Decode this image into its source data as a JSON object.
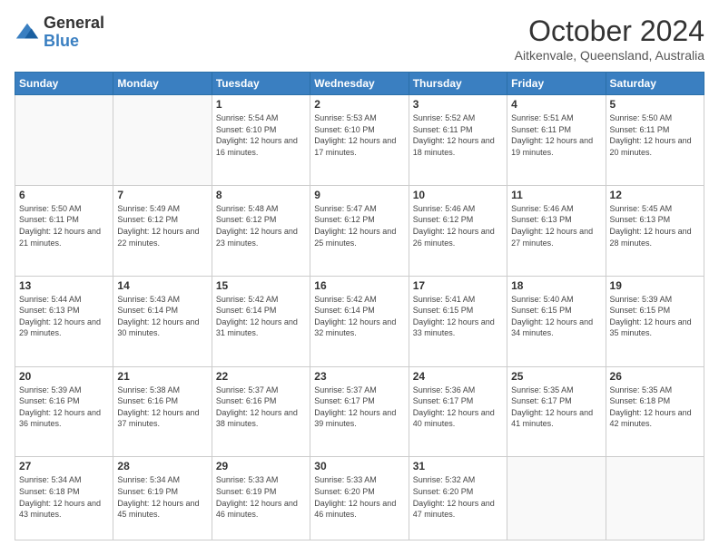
{
  "header": {
    "logo_general": "General",
    "logo_blue": "Blue",
    "month_title": "October 2024",
    "subtitle": "Aitkenvale, Queensland, Australia"
  },
  "days_of_week": [
    "Sunday",
    "Monday",
    "Tuesday",
    "Wednesday",
    "Thursday",
    "Friday",
    "Saturday"
  ],
  "weeks": [
    [
      {
        "day": "",
        "info": ""
      },
      {
        "day": "",
        "info": ""
      },
      {
        "day": "1",
        "info": "Sunrise: 5:54 AM\nSunset: 6:10 PM\nDaylight: 12 hours and 16 minutes."
      },
      {
        "day": "2",
        "info": "Sunrise: 5:53 AM\nSunset: 6:10 PM\nDaylight: 12 hours and 17 minutes."
      },
      {
        "day": "3",
        "info": "Sunrise: 5:52 AM\nSunset: 6:11 PM\nDaylight: 12 hours and 18 minutes."
      },
      {
        "day": "4",
        "info": "Sunrise: 5:51 AM\nSunset: 6:11 PM\nDaylight: 12 hours and 19 minutes."
      },
      {
        "day": "5",
        "info": "Sunrise: 5:50 AM\nSunset: 6:11 PM\nDaylight: 12 hours and 20 minutes."
      }
    ],
    [
      {
        "day": "6",
        "info": "Sunrise: 5:50 AM\nSunset: 6:11 PM\nDaylight: 12 hours and 21 minutes."
      },
      {
        "day": "7",
        "info": "Sunrise: 5:49 AM\nSunset: 6:12 PM\nDaylight: 12 hours and 22 minutes."
      },
      {
        "day": "8",
        "info": "Sunrise: 5:48 AM\nSunset: 6:12 PM\nDaylight: 12 hours and 23 minutes."
      },
      {
        "day": "9",
        "info": "Sunrise: 5:47 AM\nSunset: 6:12 PM\nDaylight: 12 hours and 25 minutes."
      },
      {
        "day": "10",
        "info": "Sunrise: 5:46 AM\nSunset: 6:12 PM\nDaylight: 12 hours and 26 minutes."
      },
      {
        "day": "11",
        "info": "Sunrise: 5:46 AM\nSunset: 6:13 PM\nDaylight: 12 hours and 27 minutes."
      },
      {
        "day": "12",
        "info": "Sunrise: 5:45 AM\nSunset: 6:13 PM\nDaylight: 12 hours and 28 minutes."
      }
    ],
    [
      {
        "day": "13",
        "info": "Sunrise: 5:44 AM\nSunset: 6:13 PM\nDaylight: 12 hours and 29 minutes."
      },
      {
        "day": "14",
        "info": "Sunrise: 5:43 AM\nSunset: 6:14 PM\nDaylight: 12 hours and 30 minutes."
      },
      {
        "day": "15",
        "info": "Sunrise: 5:42 AM\nSunset: 6:14 PM\nDaylight: 12 hours and 31 minutes."
      },
      {
        "day": "16",
        "info": "Sunrise: 5:42 AM\nSunset: 6:14 PM\nDaylight: 12 hours and 32 minutes."
      },
      {
        "day": "17",
        "info": "Sunrise: 5:41 AM\nSunset: 6:15 PM\nDaylight: 12 hours and 33 minutes."
      },
      {
        "day": "18",
        "info": "Sunrise: 5:40 AM\nSunset: 6:15 PM\nDaylight: 12 hours and 34 minutes."
      },
      {
        "day": "19",
        "info": "Sunrise: 5:39 AM\nSunset: 6:15 PM\nDaylight: 12 hours and 35 minutes."
      }
    ],
    [
      {
        "day": "20",
        "info": "Sunrise: 5:39 AM\nSunset: 6:16 PM\nDaylight: 12 hours and 36 minutes."
      },
      {
        "day": "21",
        "info": "Sunrise: 5:38 AM\nSunset: 6:16 PM\nDaylight: 12 hours and 37 minutes."
      },
      {
        "day": "22",
        "info": "Sunrise: 5:37 AM\nSunset: 6:16 PM\nDaylight: 12 hours and 38 minutes."
      },
      {
        "day": "23",
        "info": "Sunrise: 5:37 AM\nSunset: 6:17 PM\nDaylight: 12 hours and 39 minutes."
      },
      {
        "day": "24",
        "info": "Sunrise: 5:36 AM\nSunset: 6:17 PM\nDaylight: 12 hours and 40 minutes."
      },
      {
        "day": "25",
        "info": "Sunrise: 5:35 AM\nSunset: 6:17 PM\nDaylight: 12 hours and 41 minutes."
      },
      {
        "day": "26",
        "info": "Sunrise: 5:35 AM\nSunset: 6:18 PM\nDaylight: 12 hours and 42 minutes."
      }
    ],
    [
      {
        "day": "27",
        "info": "Sunrise: 5:34 AM\nSunset: 6:18 PM\nDaylight: 12 hours and 43 minutes."
      },
      {
        "day": "28",
        "info": "Sunrise: 5:34 AM\nSunset: 6:19 PM\nDaylight: 12 hours and 45 minutes."
      },
      {
        "day": "29",
        "info": "Sunrise: 5:33 AM\nSunset: 6:19 PM\nDaylight: 12 hours and 46 minutes."
      },
      {
        "day": "30",
        "info": "Sunrise: 5:33 AM\nSunset: 6:20 PM\nDaylight: 12 hours and 46 minutes."
      },
      {
        "day": "31",
        "info": "Sunrise: 5:32 AM\nSunset: 6:20 PM\nDaylight: 12 hours and 47 minutes."
      },
      {
        "day": "",
        "info": ""
      },
      {
        "day": "",
        "info": ""
      }
    ]
  ]
}
